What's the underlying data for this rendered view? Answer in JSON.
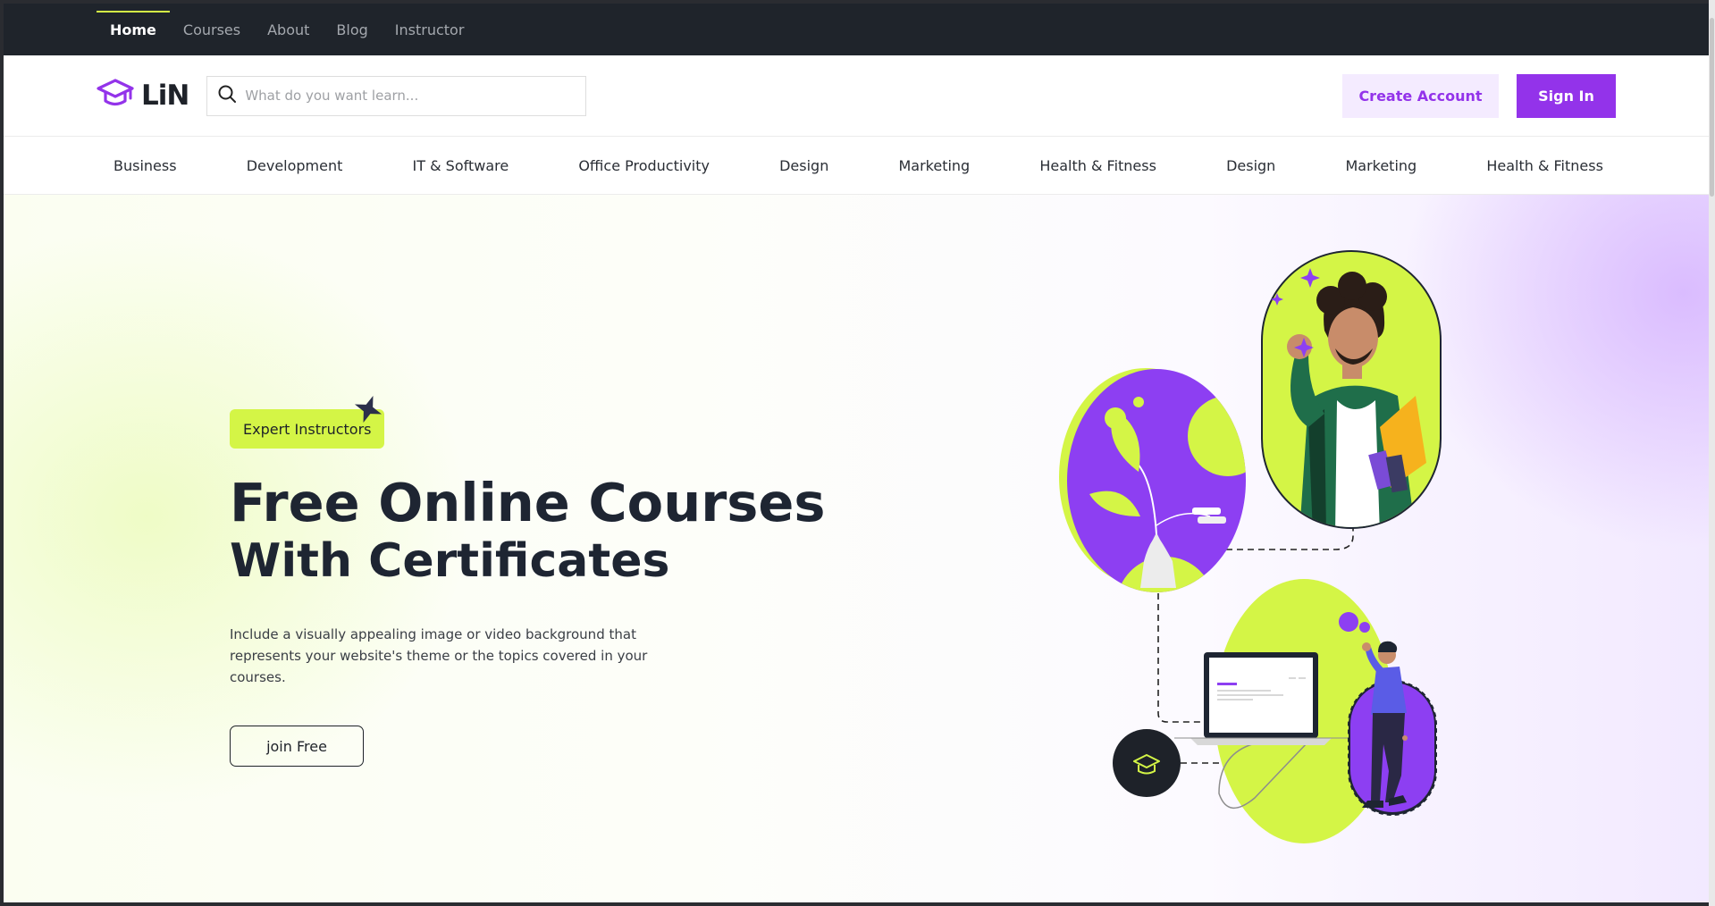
{
  "top_nav": {
    "items": [
      {
        "label": "Home",
        "active": true
      },
      {
        "label": "Courses",
        "active": false
      },
      {
        "label": "About",
        "active": false
      },
      {
        "label": "Blog",
        "active": false
      },
      {
        "label": "Instructor",
        "active": false
      }
    ]
  },
  "header": {
    "logo_text": "LiN",
    "logo_icon": "graduation-cap-icon",
    "search_placeholder": "What do you want learn...",
    "search_icon": "search-icon",
    "create_account_label": "Create Account",
    "sign_in_label": "Sign In"
  },
  "categories": [
    "Business",
    "Development",
    "IT & Software",
    "Office Productivity",
    "Design",
    "Marketing",
    "Health & Fitness",
    "Design",
    "Marketing",
    "Health & Fitness"
  ],
  "hero": {
    "badge": "Expert Instructors",
    "title_line1": "Free Online Courses",
    "title_line2": "With Certificates",
    "description": "Include a visually appealing image or video background that represents your website's theme or the topics covered in your courses.",
    "cta_label": "join Free"
  },
  "colors": {
    "accent_purple": "#9333ea",
    "accent_lime": "#d4f546",
    "dark": "#1f242b"
  }
}
